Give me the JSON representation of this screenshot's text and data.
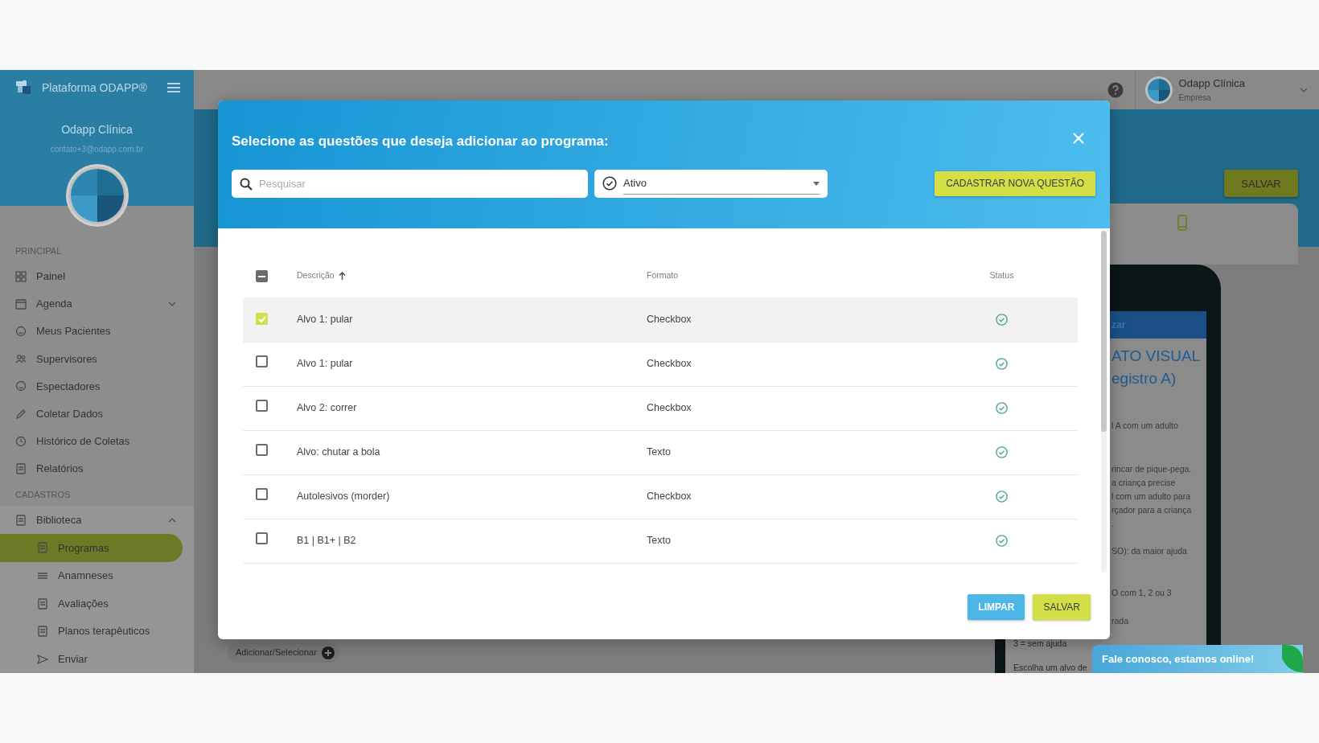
{
  "app_header": {
    "brand": "Plataforma ODAPP®"
  },
  "sidebar": {
    "org_name": "Odapp Clínica",
    "email": "contato+3@odapp.com.br",
    "sections": [
      {
        "title": "PRINCIPAL",
        "items": [
          {
            "label": "Painel",
            "kind": "link",
            "selected": false
          },
          {
            "label": "Agenda",
            "kind": "group",
            "expanded": false,
            "selected": false
          },
          {
            "label": "Meus Pacientes",
            "kind": "link",
            "selected": false
          },
          {
            "label": "Supervisores",
            "kind": "link",
            "selected": false
          },
          {
            "label": "Espectadores",
            "kind": "link",
            "selected": false
          },
          {
            "label": "Coletar Dados",
            "kind": "link",
            "selected": false
          },
          {
            "label": "Histórico de Coletas",
            "kind": "link",
            "selected": false
          },
          {
            "label": "Relatórios",
            "kind": "link",
            "selected": false
          }
        ]
      },
      {
        "title": "CADASTROS",
        "items": [
          {
            "label": "Biblioteca",
            "kind": "group",
            "expanded": true,
            "selected": false,
            "children": [
              {
                "label": "Programas",
                "selected": true
              },
              {
                "label": "Anamneses",
                "selected": false
              },
              {
                "label": "Avaliações",
                "selected": false
              },
              {
                "label": "Planos terapêuticos",
                "selected": false
              },
              {
                "label": "Enviar",
                "selected": false
              }
            ]
          }
        ]
      }
    ]
  },
  "topbar": {
    "user_name": "Odapp Clínica",
    "user_role": "Empresa"
  },
  "page": {
    "save_button": "SALVAR",
    "add_button": "Adicionar/Selecionar",
    "preview": {
      "header": "zar",
      "title": [
        "ATO VISUAL",
        "egistro A)"
      ],
      "text": [
        "l A com um adulto",
        "rincar de pique-pega.",
        "a criança precise",
        "l com um adulto para",
        "rçador para a criança",
        ".",
        "SO): da maior ajuda",
        "O com 1, 2 ou 3",
        "rada"
      ],
      "footer_text": [
        "3 = sem ajuda",
        "Escolha um alvo de"
      ]
    }
  },
  "modal": {
    "title": "Selecione as questões que deseja adicionar ao programa:",
    "search": {
      "placeholder": "Pesquisar"
    },
    "status_filter": {
      "value": "Ativo"
    },
    "new_button": "CADASTRAR NOVA QUESTÃO",
    "table": {
      "select_all": {
        "indeterminate": true
      },
      "columns": [
        {
          "label": "Descrição",
          "sorted": true,
          "descending": false
        },
        {
          "label": "Formato",
          "sorted": false
        },
        {
          "label": "Status",
          "sorted": false
        }
      ],
      "rows": [
        {
          "description": "Alvo 1: pular",
          "format": "Checkbox",
          "active": true,
          "selected": true
        },
        {
          "description": "Alvo 1: pular",
          "format": "Checkbox",
          "active": true,
          "selected": false
        },
        {
          "description": "Alvo 2: correr",
          "format": "Checkbox",
          "active": true,
          "selected": false
        },
        {
          "description": "Alvo: chutar a bola",
          "format": "Texto",
          "active": true,
          "selected": false
        },
        {
          "description": "Autolesivos (morder)",
          "format": "Checkbox",
          "active": true,
          "selected": false
        },
        {
          "description": "B1 | B1+ | B2",
          "format": "Texto",
          "active": true,
          "selected": false
        }
      ]
    },
    "buttons": [
      {
        "label": "LIMPAR",
        "kind": "secondary"
      },
      {
        "label": "SALVAR",
        "kind": "primary"
      }
    ]
  },
  "chat": {
    "label": "Fale conosco, estamos online!"
  }
}
